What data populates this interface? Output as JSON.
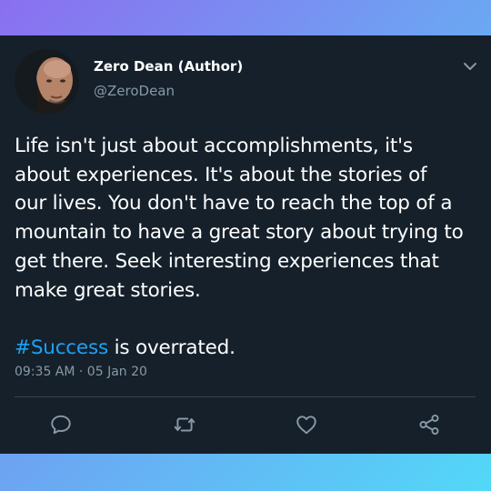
{
  "tweet": {
    "author_name": "Zero Dean (Author)",
    "author_handle": "@ZeroDean",
    "lines": [
      "Life isn't just about accomplishments, it's",
      "about experiences. It's about the stories of",
      "our lives. You don't have to reach the top of a",
      "mountain to have a great story about trying to",
      "get there. Seek interesting experiences that",
      "make great stories."
    ],
    "hashtag": "#Success",
    "hashtag_rest": " is overrated.",
    "timestamp": "09:35 AM · 05 Jan 20"
  },
  "icons": {
    "menu": "chevron-down-icon",
    "reply": "reply-icon",
    "retweet": "retweet-icon",
    "like": "heart-icon",
    "share": "share-icon"
  },
  "colors": {
    "card_background": "#15202b",
    "text": "#ffffff",
    "secondary_text": "#8899a6",
    "hashtag": "#1da1f2",
    "divider": "#38444d"
  }
}
